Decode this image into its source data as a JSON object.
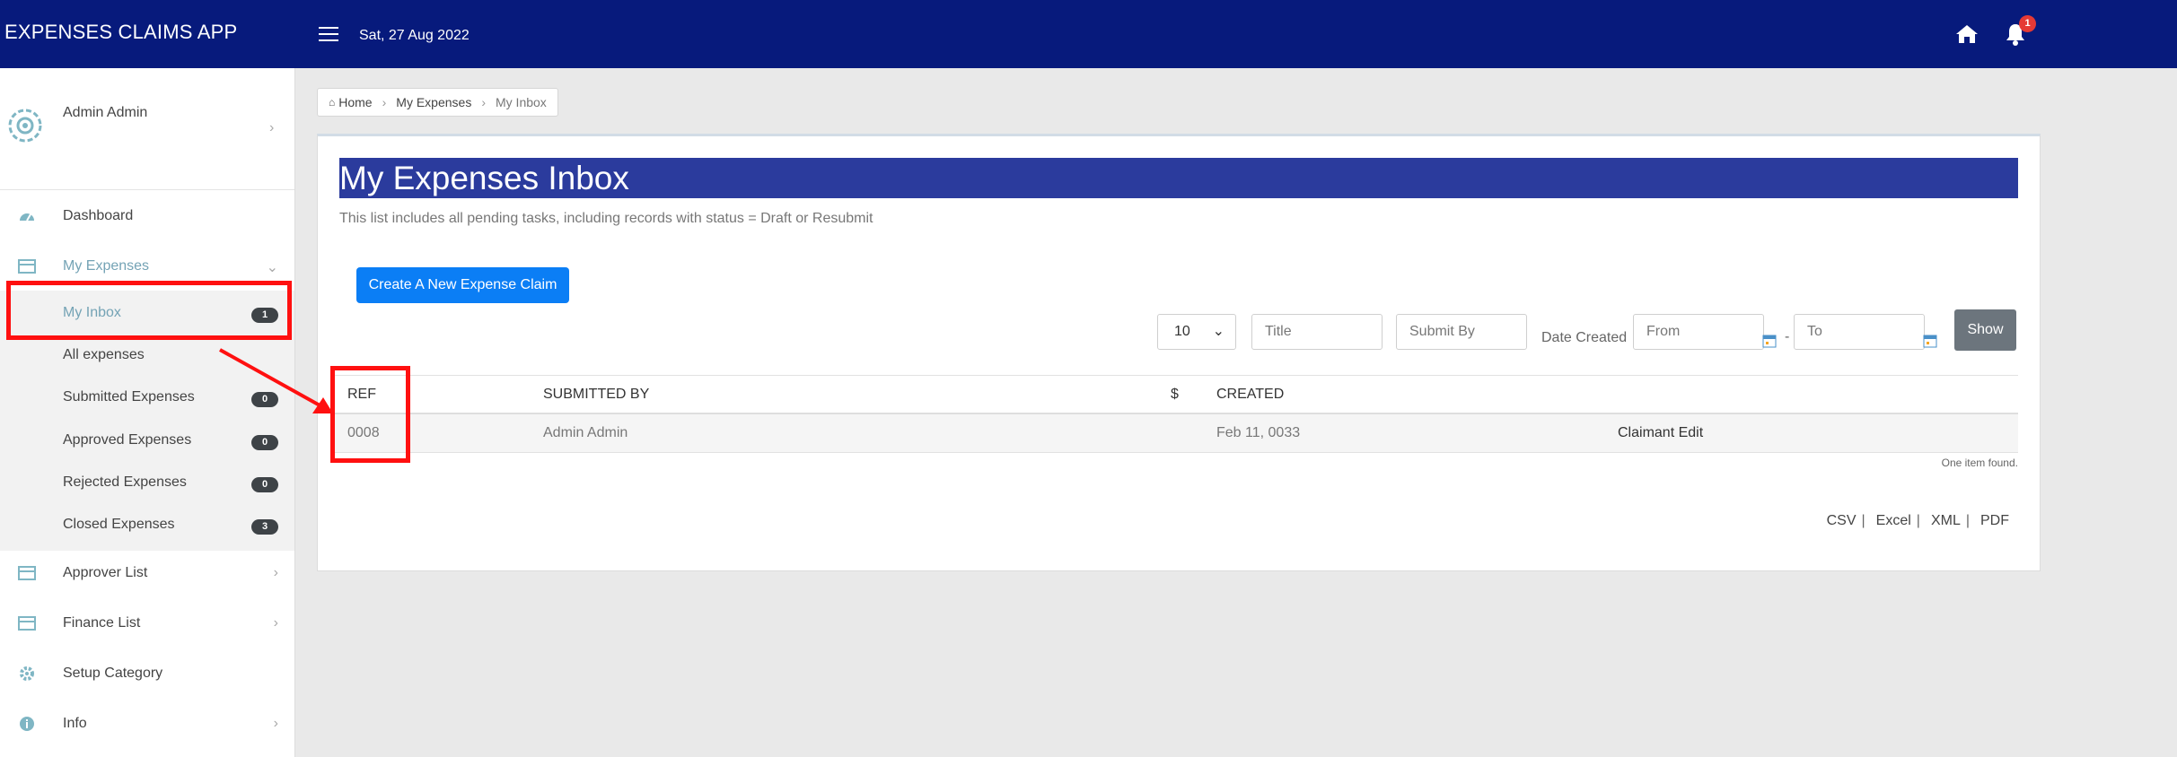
{
  "app": {
    "title": "EXPENSES CLAIMS APP",
    "date": "Sat, 27 Aug 2022",
    "notification_count": "1"
  },
  "user": {
    "name": "Admin Admin"
  },
  "sidebar": {
    "dashboard": "Dashboard",
    "my_expenses": "My Expenses",
    "sub": [
      {
        "label": "My Inbox",
        "badge": "1"
      },
      {
        "label": "All expenses",
        "badge": ""
      },
      {
        "label": "Submitted Expenses",
        "badge": "0"
      },
      {
        "label": "Approved Expenses",
        "badge": "0"
      },
      {
        "label": "Rejected Expenses",
        "badge": "0"
      },
      {
        "label": "Closed Expenses",
        "badge": "3"
      }
    ],
    "approver_list": "Approver List",
    "finance_list": "Finance List",
    "setup_category": "Setup Category",
    "info": "Info"
  },
  "breadcrumb": {
    "home": "Home",
    "my_expenses": "My Expenses",
    "current": "My Inbox"
  },
  "main": {
    "title": "My Expenses Inbox",
    "subtitle": "This list includes all pending tasks, including records with status = Draft or Resubmit",
    "create_button": "Create A New Expense Claim",
    "page_size": "10",
    "title_placeholder": "Title",
    "submit_by_placeholder": "Submit By",
    "date_created_label": "Date Created",
    "from_placeholder": "From",
    "to_placeholder": "To",
    "date_separator": "-",
    "show_button": "Show"
  },
  "table": {
    "headers": {
      "ref": "REF",
      "submitted_by": "SUBMITTED BY",
      "amount": "$",
      "created": "CREATED"
    },
    "rows": [
      {
        "ref": "0008",
        "submitted_by": "Admin Admin",
        "amount": "",
        "created": "Feb 11, 0033",
        "action": "Claimant Edit"
      }
    ],
    "summary": "One item found."
  },
  "exports": [
    "CSV",
    "Excel",
    "XML",
    "PDF"
  ],
  "colors": {
    "navbar": "#071a7c",
    "title_bar": "#2b3b9d",
    "primary_button": "#0b7ef5",
    "annotation": "#ff1010"
  }
}
